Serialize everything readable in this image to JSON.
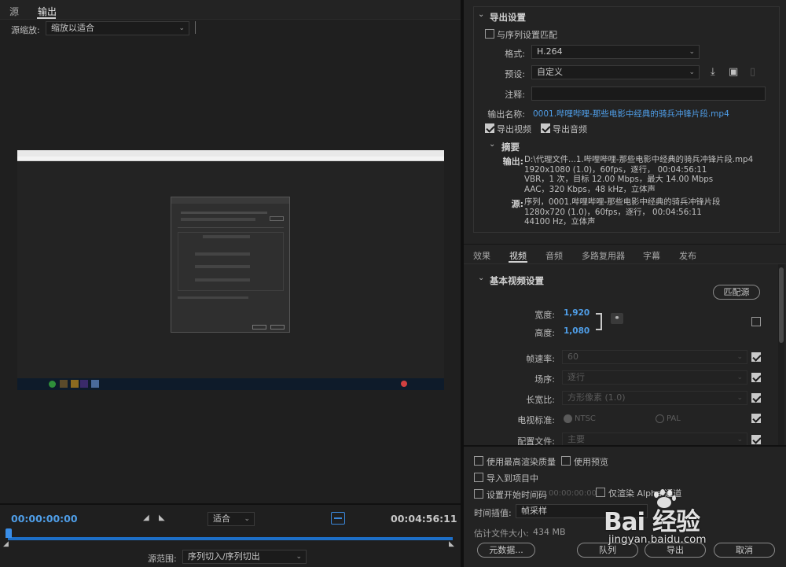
{
  "left": {
    "tabs": [
      {
        "label": "源"
      },
      {
        "label": "输出"
      }
    ],
    "source_scaling_label": "源缩放:",
    "source_scaling_value": "缩放以适合",
    "timecode_start": "00:00:00:00",
    "timecode_end": "00:04:56:11",
    "fit_value": "适合",
    "source_range_label": "源范围:",
    "source_range_value": "序列切入/序列切出"
  },
  "export": {
    "title": "导出设置",
    "match_sequence": "与序列设置匹配",
    "format_label": "格式:",
    "format_value": "H.264",
    "preset_label": "预设:",
    "preset_value": "自定义",
    "comment_label": "注释:",
    "output_name_label": "输出名称:",
    "output_name": "0001.哔哩哔哩-那些电影中经典的骑兵冲锋片段.mp4",
    "export_video": "导出视频",
    "export_audio": "导出音频",
    "summary_title": "摘要",
    "output_label": "输出:",
    "output_lines": [
      "D:\\代理文件...1.哔哩哔哩-那些电影中经典的骑兵冲锋片段.mp4",
      "1920x1080 (1.0)，60fps，逐行，  00:04:56:11",
      "VBR，1 次，目标 12.00 Mbps，最大 14.00 Mbps",
      "AAC，320 Kbps，48 kHz，立体声"
    ],
    "source_label": "源:",
    "source_lines": [
      "序列，0001.哔哩哔哩-那些电影中经典的骑兵冲锋片段",
      "1280x720 (1.0)，60fps，逐行，  00:04:56:11",
      "44100 Hz，立体声"
    ]
  },
  "tabs2": [
    {
      "label": "效果"
    },
    {
      "label": "视频"
    },
    {
      "label": "音频"
    },
    {
      "label": "多路复用器"
    },
    {
      "label": "字幕"
    },
    {
      "label": "发布"
    }
  ],
  "video": {
    "section_title": "基本视频设置",
    "match_source_btn": "匹配源",
    "width_label": "宽度:",
    "width_value": "1,920",
    "height_label": "高度:",
    "height_value": "1,080",
    "framerate_label": "帧速率:",
    "framerate_value": "60",
    "field_order_label": "场序:",
    "field_order_value": "逐行",
    "aspect_label": "长宽比:",
    "aspect_value": "方形像素 (1.0)",
    "tv_standard_label": "电视标准:",
    "ntsc": "NTSC",
    "pal": "PAL",
    "profile_label": "配置文件:",
    "profile_value": "主要"
  },
  "bottom": {
    "max_render_quality": "使用最高渲染质量",
    "use_previews": "使用预览",
    "import_into_project": "导入到项目中",
    "set_start_timecode": "设置开始时间码",
    "start_timecode_value": "00:00:00:00",
    "render_alpha_only": "仅渲染 Alpha 通道",
    "time_interp_label": "时间插值:",
    "time_interp_value": "帧采样",
    "est_file_size_label": "估计文件大小:",
    "est_file_size_value": "434 MB",
    "metadata_btn": "元数据...",
    "queue_btn": "队列",
    "export_btn": "导出",
    "cancel_btn": "取消"
  },
  "watermark": {
    "brand": "Bai 经验",
    "url": "jingyan.baidu.com"
  }
}
